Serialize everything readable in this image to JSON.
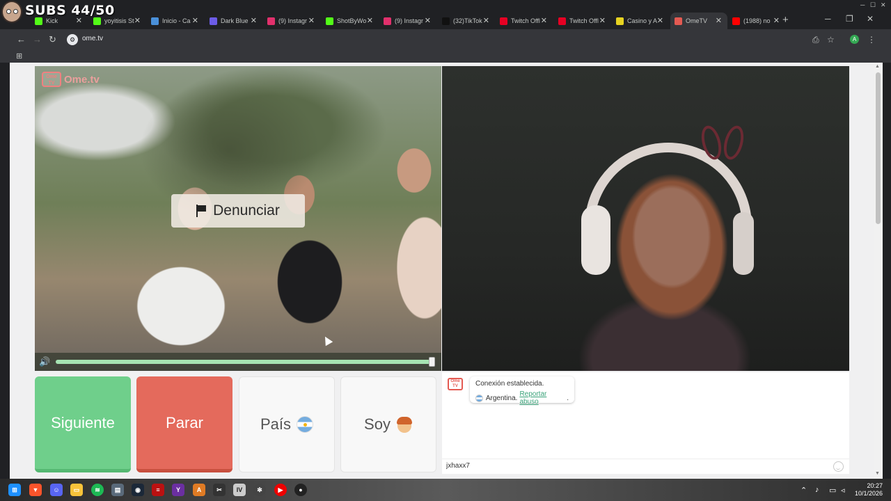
{
  "overlay": {
    "subs_text": "SUBS 44/50"
  },
  "browser": {
    "tabs": [
      {
        "title": "Kick",
        "icon": "kick-icon",
        "color": "#53fc18"
      },
      {
        "title": "yoyitisis St",
        "icon": "kick-icon",
        "color": "#53fc18"
      },
      {
        "title": "Inicio - Ca",
        "icon": "chrome-page-icon",
        "color": "#4a90d9"
      },
      {
        "title": "Dark Blue",
        "icon": "shield-icon",
        "color": "#6c5ce7"
      },
      {
        "title": "(9) Instagr",
        "icon": "instagram-icon",
        "color": "#e1306c"
      },
      {
        "title": "ShotByWo",
        "icon": "kick-icon",
        "color": "#53fc18"
      },
      {
        "title": "(9) Instagr",
        "icon": "instagram-icon",
        "color": "#e1306c"
      },
      {
        "title": "(32)TikTok",
        "icon": "tiktok-icon",
        "color": "#111111"
      },
      {
        "title": "Twitch Offl",
        "icon": "pinterest-icon",
        "color": "#e60023"
      },
      {
        "title": "Twitch Offl",
        "icon": "pinterest-icon",
        "color": "#e60023"
      },
      {
        "title": "Casino y A",
        "icon": "casino-icon",
        "color": "#e7d321"
      },
      {
        "title": "OmeTV",
        "icon": "ometv-icon",
        "color": "#e45a52"
      },
      {
        "title": "(1988) no",
        "icon": "youtube-icon",
        "color": "#ff0000"
      }
    ],
    "url": "ome.tv"
  },
  "video": {
    "watermark": "Ome.tv",
    "watermark_badge": "Ome TV",
    "report_label": "Denunciar",
    "volume_level": 1.0
  },
  "controls": {
    "next_label": "Siguiente",
    "stop_label": "Parar",
    "country_label": "País",
    "gender_label": "Soy"
  },
  "chat": {
    "logo": "Ome TV",
    "message_line1": "Conexión establecida.",
    "country": "Argentina.",
    "report_link": "Reportar abuso",
    "report_suffix": ".",
    "input_value": "jxhaxx7"
  },
  "taskbar": {
    "time": "20:27",
    "date": "10/1/2026"
  }
}
